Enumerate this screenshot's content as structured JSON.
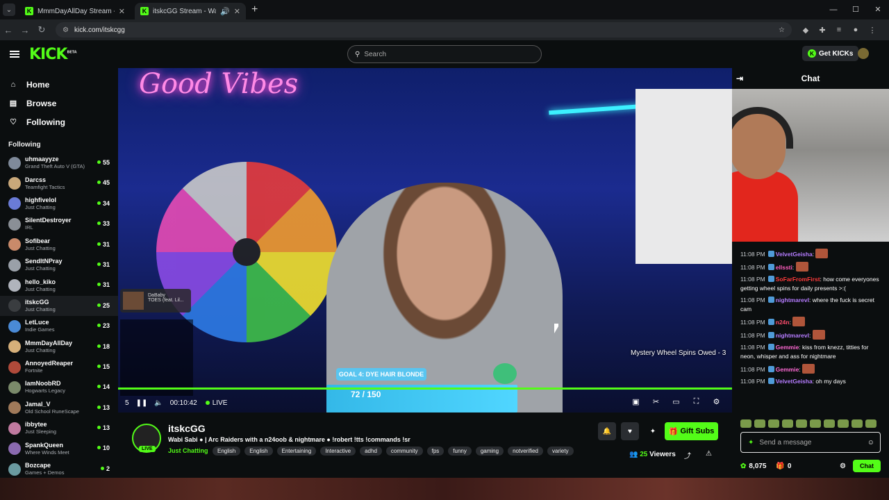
{
  "browser": {
    "tabs": [
      {
        "title": "MmmDayAllDay Stream - Watch"
      },
      {
        "title": "itskcGG Stream - Watch Live"
      }
    ],
    "url": "kick.com/itskcgg"
  },
  "header": {
    "logo": "KICK",
    "logo_badge": "BETA",
    "search_placeholder": "Search",
    "get_kicks": "Get KICKs"
  },
  "sidebar": {
    "nav": [
      {
        "label": "Home"
      },
      {
        "label": "Browse"
      },
      {
        "label": "Following"
      }
    ],
    "following_title": "Following",
    "following": [
      {
        "name": "uhmaayyze",
        "game": "Grand Theft Auto V (GTA)",
        "viewers": "55",
        "color": "#7f8a9a"
      },
      {
        "name": "Darcss",
        "game": "Teamfight Tactics",
        "viewers": "45",
        "color": "#c9a87a"
      },
      {
        "name": "highfivelol",
        "game": "Just Chatting",
        "viewers": "34",
        "color": "#6a7bd6"
      },
      {
        "name": "SilentDestroyer",
        "game": "IRL",
        "viewers": "33",
        "color": "#8a8f96"
      },
      {
        "name": "Sofibear",
        "game": "Just Chatting",
        "viewers": "31",
        "color": "#c98a6a"
      },
      {
        "name": "SendItNPray",
        "game": "Just Chatting",
        "viewers": "31",
        "color": "#9aa0a8"
      },
      {
        "name": "hello_kiko",
        "game": "Just Chatting",
        "viewers": "31",
        "color": "#b0b4bc"
      },
      {
        "name": "itskcGG",
        "game": "Just Chatting",
        "viewers": "25",
        "color": "#3a3d40"
      },
      {
        "name": "LetLuce",
        "game": "Indie Games",
        "viewers": "23",
        "color": "#4a8ad6"
      },
      {
        "name": "MmmDayAllDay",
        "game": "Just Chatting",
        "viewers": "18",
        "color": "#d6b07a"
      },
      {
        "name": "AnnoyedReaper",
        "game": "Fortnite",
        "viewers": "15",
        "color": "#b04a3a"
      },
      {
        "name": "IamNoobRD",
        "game": "Hogwarts Legacy",
        "viewers": "14",
        "color": "#7a8a6a"
      },
      {
        "name": "Jamal_V",
        "game": "Old School RuneScape",
        "viewers": "13",
        "color": "#a07a5a"
      },
      {
        "name": "ibbytee",
        "game": "Just Sleeping",
        "viewers": "13",
        "color": "#c07aa0"
      },
      {
        "name": "SpankQueen",
        "game": "Where Winds Meet",
        "viewers": "10",
        "color": "#8a6ab0"
      },
      {
        "name": "Bozcape",
        "game": "Games + Demos",
        "viewers": "2",
        "color": "#6a9aa0"
      }
    ]
  },
  "player": {
    "neon_sign": "Good Vibes",
    "now_playing": "DaBaby\nTOES (feat. Lil...",
    "mystery_overlay": "Mystery Wheel Spins Owed - 3",
    "goal_label": "GOAL 4: DYE HAIR BLONDE",
    "goal_value": "72 / 150",
    "goal_progress": 0.48,
    "time": "00:10:42",
    "live": "LIVE",
    "volume_num": "5"
  },
  "stream": {
    "channel": "itskcGG",
    "live_badge": "LIVE",
    "title": "Wabi Sabi ● | Arc Raiders with a n24oob & nightmare ● !robert !tts !commands !sr",
    "category": "Just Chatting",
    "tags": [
      "English",
      "English",
      "Entertaining",
      "Interactive",
      "adhd",
      "community",
      "fps",
      "funny",
      "gaming",
      "notverified",
      "variety"
    ],
    "gift_subs": "Gift Subs",
    "viewers_num": "25",
    "viewers_label": "Viewers"
  },
  "chat": {
    "title": "Chat",
    "messages": [
      {
        "time": "11:08 PM",
        "user": "VelvetGeisha",
        "color": "#b57cff",
        "text": ""
      },
      {
        "time": "11:08 PM",
        "user": "ellssti",
        "color": "#ff5dbf",
        "text": ""
      },
      {
        "time": "11:08 PM",
        "user": "SoFarFromFirst",
        "color": "#ff3b3b",
        "text": "how come everyones getting wheel spins for daily presents >:("
      },
      {
        "time": "11:08 PM",
        "user": "nightmarevl",
        "color": "#b57cff",
        "text": "where the fuck is secret cam"
      },
      {
        "time": "11:08 PM",
        "user": "n24n",
        "color": "#ff4d6d",
        "text": ""
      },
      {
        "time": "11:08 PM",
        "user": "nightmarevl",
        "color": "#b57cff",
        "text": ""
      },
      {
        "time": "11:08 PM",
        "user": "Gemmie",
        "color": "#ff6ad5",
        "text": "kiss from knezz, titties for neon, whisper and ass for nightmare"
      },
      {
        "time": "11:08 PM",
        "user": "Gemmie",
        "color": "#ff6ad5",
        "text": ""
      },
      {
        "time": "11:08 PM",
        "user": "VelvetGeisha",
        "color": "#b57cff",
        "text": "oh my days"
      }
    ],
    "input_placeholder": "Send a message",
    "kicks": "8,075",
    "gifts": "0",
    "chat_button": "Chat"
  },
  "colors": {
    "accent": "#53fc18",
    "background": "#0b0e0f"
  }
}
